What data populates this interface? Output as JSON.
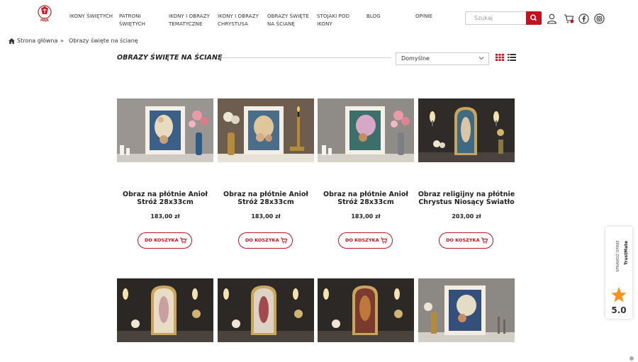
{
  "header": {
    "nav": [
      {
        "line1": "IKONY ŚWIĘTYCH",
        "line2": ""
      },
      {
        "line1": "PATRONI",
        "line2": "ŚWIĘTYCH"
      },
      {
        "line1": "IKONY I OBRAZY",
        "line2": "TEMATYCZNE"
      },
      {
        "line1": "IKONY I OBRAZY",
        "line2": "CHRYSTUSA"
      },
      {
        "line1": "OBRAZY ŚWIĘTE",
        "line2": "NA ŚCIANĘ"
      },
      {
        "line1": "STOJAKI POD",
        "line2": "IKONY"
      },
      {
        "line1": "BLOG",
        "line2": ""
      },
      {
        "line1": "OPINIE",
        "line2": ""
      }
    ],
    "logo_text": "MAJK",
    "search_placeholder": "Szukaj",
    "icons": [
      "search-icon",
      "user-icon",
      "cart-icon",
      "facebook-icon",
      "instagram-icon"
    ]
  },
  "breadcrumb": {
    "home": "Strona główna",
    "separator": "»",
    "current": "Obrazy święte na ścianę"
  },
  "listing": {
    "title": "OBRAZY ŚWIĘTE NA ŚCIANĘ",
    "sort_value": "Domyślne"
  },
  "products": [
    {
      "name1": "Obraz na płótnie Anioł",
      "name2": "Stróż 28x33cm",
      "price": "183,00 zł",
      "button": "DO KOSZYKA"
    },
    {
      "name1": "Obraz na płótnie Anioł",
      "name2": "Stróż 28x33cm",
      "price": "183,00 zł",
      "button": "DO KOSZYKA"
    },
    {
      "name1": "Obraz na płótnie Anioł",
      "name2": "Stróż 28x33cm",
      "price": "183,00 zł",
      "button": "DO KOSZYKA"
    },
    {
      "name1": "Obraz religijny na płótnie",
      "name2": "Chrystus Niosący Światło",
      "price": "203,00 zł",
      "button": "DO KOSZYKA"
    }
  ],
  "trustmate": {
    "label": "SPRAWDŹ OPINIE",
    "brand": "TrustMate",
    "rating": "5.0"
  },
  "colors": {
    "accent": "#c1121f"
  }
}
